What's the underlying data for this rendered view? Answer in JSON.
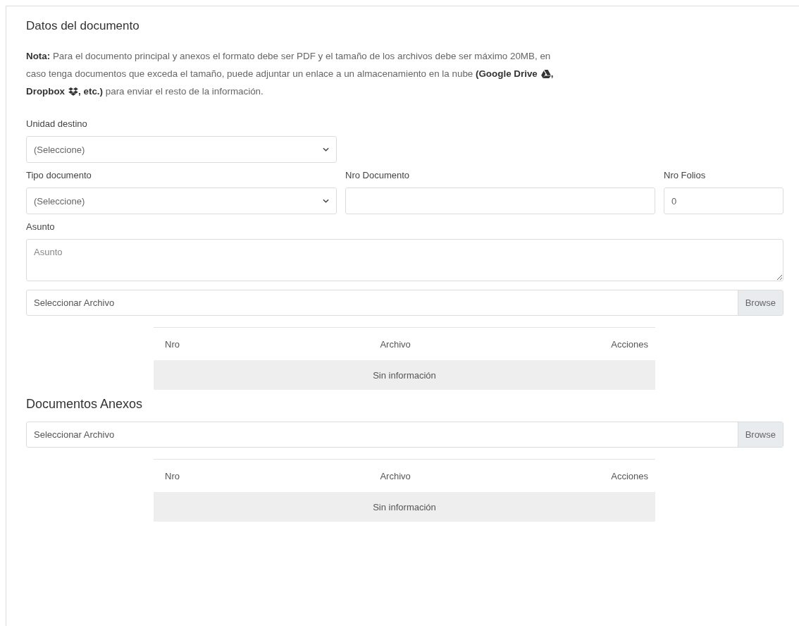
{
  "section_title": "Datos del documento",
  "note": {
    "line1": "**Nota:** Para el documento principal y anexos el formato debe ser PDF y el tamaño de los archivos debe ser máximo 20MB, en",
    "line2": "caso tenga documentos que exceda el tamaño, puede adjuntar un enlace a un almacenamiento en la nube **(Google Drive**",
    "line2_end": ",",
    "line3": "Dropbox",
    "line3_end": "**, etc.)** para enviar el resto de la información."
  },
  "unidad": {
    "label": "Unidad destino",
    "value": "(Seleccione)"
  },
  "tipo": {
    "label": "Tipo documento",
    "value": "(Seleccione)"
  },
  "nro_documento": {
    "label": "Nro Documento"
  },
  "nro_folios": {
    "label": "Nro Folios",
    "value": "0"
  },
  "asunto": {
    "label": "Asunto",
    "placeholder": "Asunto"
  },
  "main_file": {
    "placeholder": "Seleccionar Archivo",
    "button": "Browse",
    "table": {
      "columns": [
        "Nro",
        "Archivo",
        "Acciones"
      ],
      "empty": "Sin información"
    }
  },
  "annex_title": "Documentos Anexos",
  "annex_file": {
    "placeholder": "Seleccionar Archivo",
    "button": "Browse",
    "table": {
      "columns": [
        "Nro",
        "Archivo",
        "Acciones"
      ],
      "empty": "Sin información"
    }
  }
}
